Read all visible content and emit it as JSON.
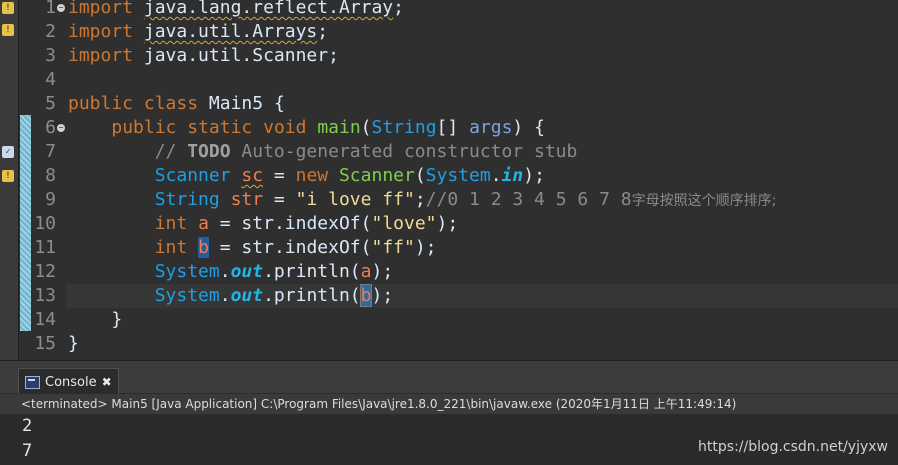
{
  "editor": {
    "line_numbers": [
      "1",
      "2",
      "3",
      "4",
      "5",
      "6",
      "7",
      "8",
      "9",
      "10",
      "11",
      "12",
      "13",
      "14",
      "15"
    ],
    "l1": {
      "kw": "import",
      "pkg": "java.lang.reflect.Array",
      "semi": ";"
    },
    "l2": {
      "kw": "import",
      "pkg": "java.util.Arrays",
      "semi": ";"
    },
    "l3": {
      "kw": "import",
      "pkg": "java.util.Scanner",
      "semi": ";"
    },
    "l5": {
      "kw1": "public",
      "kw2": "class",
      "name": "Main5",
      "brace": "{"
    },
    "l6": {
      "kw1": "public",
      "kw2": "static",
      "kw3": "void",
      "method": "main",
      "type": "String",
      "rest": "[] ",
      "arg": "args",
      "close": ") {"
    },
    "l7": {
      "comment_start": "// ",
      "todo": "TODO",
      "comment_rest": " Auto-generated constructor stub"
    },
    "l8": {
      "type": "Scanner",
      "var": "sc",
      "eq": " = ",
      "kw": "new",
      "type2": "Scanner",
      "paren": "(",
      "cls": "System",
      "dot": ".",
      "fld": "in",
      "end": ");"
    },
    "l9": {
      "type": "String",
      "var": "str",
      "eq": " = ",
      "str": "\"i love ff\"",
      "semi": ";",
      "comment": "//0 1 2 3 4 5 6 7 8",
      "cjk": "字母按照这个顺序排序;"
    },
    "l10": {
      "kw": "int",
      "var": "a",
      "eq": " = ",
      "obj": "str",
      "call": ".indexOf(",
      "str": "\"love\"",
      "end": ");"
    },
    "l11": {
      "kw": "int",
      "var": "b",
      "eq": " = ",
      "obj": "str",
      "call": ".indexOf(",
      "str": "\"ff\"",
      "end": ");"
    },
    "l12": {
      "cls": "System",
      "dot": ".",
      "fld": "out",
      "call": ".println(",
      "var": "a",
      "end": ");"
    },
    "l13": {
      "cls": "System",
      "dot": ".",
      "fld": "out",
      "call": ".println(",
      "var": "b",
      "end": ");"
    },
    "l14": {
      "brace": "}"
    },
    "l15": {
      "brace": "}"
    }
  },
  "console": {
    "tab_label": "Console",
    "tab_close": "✖",
    "status": "<terminated> Main5 [Java Application] C:\\Program Files\\Java\\jre1.8.0_221\\bin\\javaw.exe (2020年1月11日 上午11:49:14)",
    "output": [
      "2",
      "7"
    ]
  },
  "watermark": "https://blog.csdn.net/yjyxw",
  "icons": {
    "fold": "collapse-icon",
    "warn": "warning-icon",
    "task": "task-icon",
    "console": "console-icon"
  },
  "colors": {
    "keyword": "#cc7832",
    "type": "#1e9fe6",
    "string": "#eddd97",
    "method": "#7fcf4d",
    "comment": "#8a8a8a"
  }
}
